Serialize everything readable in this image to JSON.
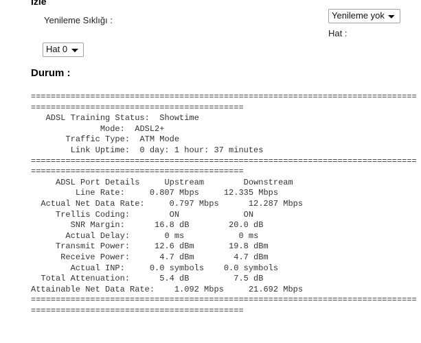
{
  "header": {
    "title": "İzle",
    "refresh_label": "Yenileme Sıklığı :",
    "line_label": "Hat :",
    "status_title": "Durum :"
  },
  "controls": {
    "refresh_select": {
      "name": "refresh-rate-select",
      "value": "Yenileme yok",
      "options": [
        "Yenileme yok"
      ]
    },
    "line_select": {
      "name": "line-select",
      "value": "Hat 0",
      "options": [
        "Hat 0"
      ]
    }
  },
  "status": {
    "separator": "=========================================================================================================================",
    "training": {
      "adsl_training_status_label": "ADSL Training Status:",
      "adsl_training_status_value": "Showtime",
      "mode_label": "Mode:",
      "mode_value": "ADSL2+",
      "traffic_type_label": "Traffic Type:",
      "traffic_type_value": "ATM Mode",
      "link_uptime_label": "Link Uptime:",
      "link_uptime_value": "0 day: 1 hour: 37 minutes"
    },
    "port_details": {
      "section_label": "ADSL Port Details",
      "col_upstream": "Upstream",
      "col_downstream": "Downstream",
      "rows": [
        {
          "label": "Line Rate:",
          "upstream": "0.807 Mbps",
          "downstream": "12.335 Mbps"
        },
        {
          "label": "Actual Net Data Rate:",
          "upstream": "0.797 Mbps",
          "downstream": "12.287 Mbps"
        },
        {
          "label": "Trellis Coding:",
          "upstream": "ON",
          "downstream": "ON"
        },
        {
          "label": "SNR Margin:",
          "upstream": "16.8 dB",
          "downstream": "20.0 dB"
        },
        {
          "label": "Actual Delay:",
          "upstream": "0 ms",
          "downstream": "0 ms"
        },
        {
          "label": "Transmit Power:",
          "upstream": "12.6 dBm",
          "downstream": "19.8 dBm"
        },
        {
          "label": "Receive Power:",
          "upstream": "4.7 dBm",
          "downstream": "4.7 dBm"
        },
        {
          "label": "Actual INP:",
          "upstream": "0.0 symbols",
          "downstream": "0.0 symbols"
        },
        {
          "label": "Total Attenuation:",
          "upstream": "5.4 dB",
          "downstream": "7.5 dB"
        },
        {
          "label": "Attainable Net Data Rate:",
          "upstream": "1.092 Mbps",
          "downstream": "21.692 Mbps"
        }
      ]
    },
    "dump_text": "=========================================================================================================================\n   ADSL Training Status:  Showtime\n              Mode:  ADSL2+\n       Traffic Type:  ATM Mode\n        Link Uptime:  0 day: 1 hour: 37 minutes\n=========================================================================================================================\n     ADSL Port Details     Upstream        Downstream\n         Line Rate:     0.807 Mbps     12.335 Mbps\n  Actual Net Data Rate:     0.797 Mbps      12.287 Mbps\n     Trellis Coding:        ON             ON\n        SNR Margin:      16.8 dB        20.0 dB\n       Actual Delay:       0 ms           0 ms\n     Transmit Power:     12.6 dBm       19.8 dBm\n      Receive Power:      4.7 dBm        4.7 dBm\n        Actual INP:     0.0 symbols    0.0 symbols\n  Total Attenuation:      5.4 dB         7.5 dB\nAttainable Net Data Rate:    1.092 Mbps     21.692 Mbps\n========================================================================================================================="
  },
  "colors": {
    "text": "#333333",
    "heading": "#000000",
    "select_border": "#a0a0a0",
    "background": "#ffffff"
  }
}
